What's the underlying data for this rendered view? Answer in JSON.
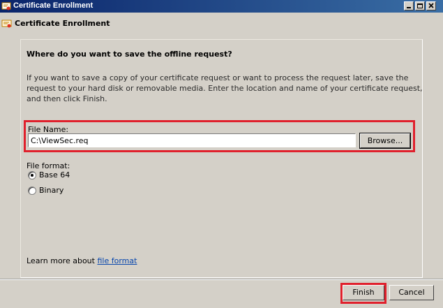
{
  "window": {
    "title": "Certificate Enrollment",
    "app_icon": "certificate-icon",
    "controls": [
      "minimize-icon",
      "maximize-icon",
      "close-icon"
    ]
  },
  "header": {
    "icon": "certificate-icon",
    "title": "Certificate Enrollment"
  },
  "main": {
    "question": "Where do you want to save the offline request?",
    "description": "If you want to save a copy of your certificate request or want to process the request later, save the request to your hard disk or removable media. Enter the location and name of your certificate request, and then click Finish.",
    "file_name": {
      "label": "File Name:",
      "value": "C:\\ViewSec.req",
      "browse_label": "Browse..."
    },
    "file_format": {
      "label": "File format:",
      "options": [
        {
          "label": "Base 64",
          "selected": true
        },
        {
          "label": "Binary",
          "selected": false
        }
      ]
    },
    "learn_more": {
      "prefix": "Learn more about ",
      "link": "file format"
    }
  },
  "footer": {
    "finish_label": "Finish",
    "cancel_label": "Cancel"
  },
  "colors": {
    "highlight": "#e0202c",
    "title_bar": "#0a246a",
    "link": "#0645ad"
  }
}
